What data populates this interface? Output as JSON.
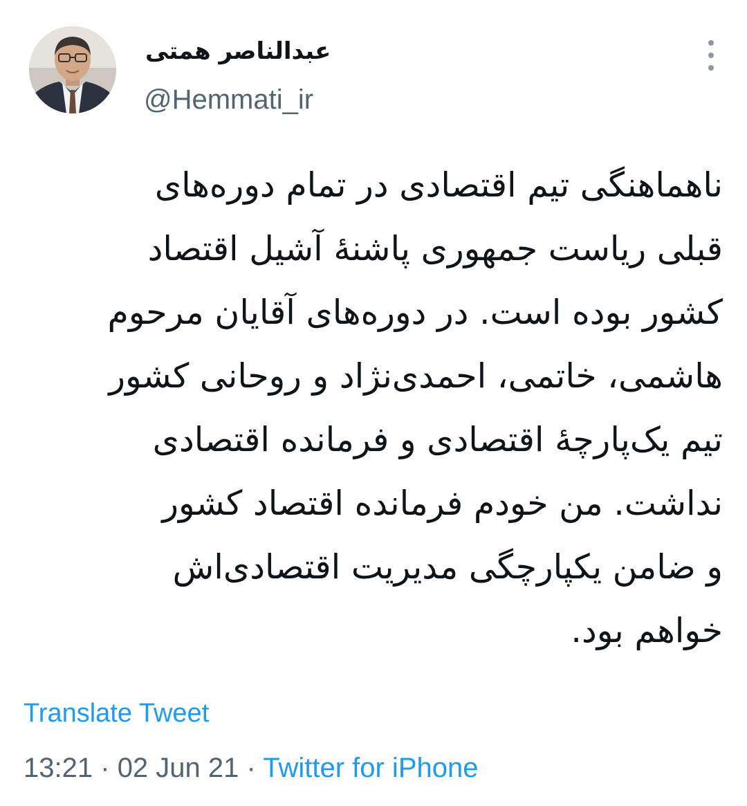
{
  "author": {
    "display_name": "عبدالناصر همتی",
    "handle": "@Hemmati_ir"
  },
  "tweet": {
    "lines": [
      "ناهماهنگی تیم اقتصادی در تمام دوره‌های",
      "قبلی ریاست جمهوری پاشنهٔ آشیل اقتصاد",
      "کشور بوده است. در دوره‌های آقایان مرحوم",
      "هاشمی، خاتمی، احمدی‌نژاد و روحانی کشور",
      "تیم یک‌پارچهٔ اقتصادی و فرمانده اقتصادی",
      "نداشت. من خودم فرمانده اقتصاد کشور",
      "و ضامن یکپارچگی مدیریت اقتصادی‌اش",
      "خواهم بود."
    ],
    "translate_label": "Translate Tweet",
    "time": "13:21",
    "date": "02 Jun 21",
    "separator": "·",
    "source": "Twitter for iPhone"
  },
  "icons": {
    "more": "more-vertical-icon",
    "avatar": "profile-photo"
  },
  "colors": {
    "link": "#1d9bf0",
    "secondary_text": "#536471",
    "primary_text": "#0f1419",
    "background": "#ffffff"
  }
}
